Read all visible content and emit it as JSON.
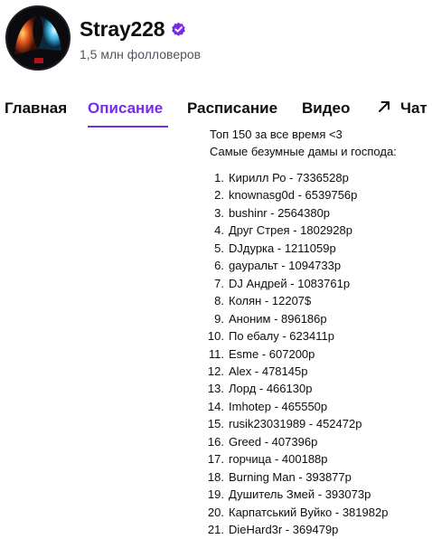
{
  "channel": {
    "name": "Stray228",
    "followers": "1,5 млн фолловеров",
    "verified_color": "#772ce8"
  },
  "tabs": [
    {
      "label": "Главная"
    },
    {
      "label": "Описание",
      "active": true
    },
    {
      "label": "Расписание"
    },
    {
      "label": "Видео"
    },
    {
      "label": "Чат"
    }
  ],
  "description": {
    "line1": "Топ 150 за все время <3",
    "line2": "Самые безумные дамы и господа:"
  },
  "donors": [
    {
      "num": "1.",
      "text": "Кирилл Ро - 7336528р"
    },
    {
      "num": "2.",
      "text": "knownasg0d - 6539756р"
    },
    {
      "num": "3.",
      "text": "bushinr - 2564380р"
    },
    {
      "num": "4.",
      "text": "Друг Стрея - 1802928р"
    },
    {
      "num": "5.",
      "text": "DJдурка - 1211059р"
    },
    {
      "num": "6.",
      "text": "gayральт - 1094733р"
    },
    {
      "num": "7.",
      "text": "DJ Андрей - 1083761р"
    },
    {
      "num": "8.",
      "text": "Колян - 12207$"
    },
    {
      "num": "9.",
      "text": "Аноним - 896186р"
    },
    {
      "num": "10.",
      "text": "По ебалу - 623411р"
    },
    {
      "num": "11.",
      "text": "Esme - 607200р"
    },
    {
      "num": "12.",
      "text": "Alex - 478145р"
    },
    {
      "num": "13.",
      "text": "Лорд - 466130р"
    },
    {
      "num": "14.",
      "text": "Imhotep - 465550р"
    },
    {
      "num": "15.",
      "text": "rusik23031989 - 452472р"
    },
    {
      "num": "16.",
      "text": "Greed - 407396р"
    },
    {
      "num": "17.",
      "text": "горчица - 400188р"
    },
    {
      "num": "18.",
      "text": "Burning Man - 393877р"
    },
    {
      "num": "19.",
      "text": "Душитель Змей - 393073р"
    },
    {
      "num": "20.",
      "text": "Карпатський Вуйко - 381982р"
    },
    {
      "num": "21.",
      "text": "DieHard3r - 369479р"
    }
  ]
}
